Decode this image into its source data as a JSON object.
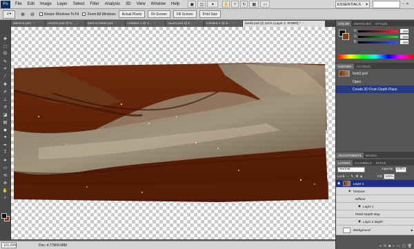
{
  "menubar": {
    "logo": "Ps",
    "items": [
      "File",
      "Edit",
      "Image",
      "Layer",
      "Select",
      "Filter",
      "Analysis",
      "3D",
      "View",
      "Window",
      "Help"
    ],
    "workspace": "ESSENTIALS"
  },
  "optbar": {
    "resize_windows": "Resize Windows To Fit",
    "zoom_all": "Zoom All Windows",
    "buttons": [
      "Actual Pixels",
      "Fit Screen",
      "Fill Screen",
      "Print Size"
    ]
  },
  "tabs": [
    {
      "label": "eleven1.psd",
      "active": false
    },
    {
      "label": "cave01.psd @ 5...",
      "active": false
    },
    {
      "label": "start-scrolder.psd",
      "active": false
    },
    {
      "label": "Untitled-1 @ 1...",
      "active": false
    },
    {
      "label": "cave3.psd @ 5...",
      "active": false
    },
    {
      "label": "Untitled-2 @ 5...",
      "active": false
    },
    {
      "label": "land2.psd @ 111% (Layer 2, RGB/8) *",
      "active": true
    }
  ],
  "status": {
    "zoom": "115.29%",
    "doc": "Doc: 4.77M/9.08M"
  },
  "color_panel": {
    "tabs": [
      "COLOR",
      "SWATCHES",
      "STYLES"
    ],
    "channels": [
      {
        "label": "R",
        "value": "255",
        "color": "#ff3b3b"
      },
      {
        "label": "G",
        "value": "255",
        "color": "#3bdc3b"
      },
      {
        "label": "B",
        "value": "255",
        "color": "#3b6bff"
      }
    ]
  },
  "history_panel": {
    "tabs": [
      "HISTORY",
      "ACTIONS"
    ],
    "snapshot": "land2.psd",
    "items": [
      {
        "label": "Open",
        "active": false
      },
      {
        "label": "Create 3D From Depth Plane",
        "active": true
      }
    ]
  },
  "adjust_tabs": [
    "ADJUSTMENTS",
    "MASKS"
  ],
  "layers_panel": {
    "tabs": [
      "LAYERS",
      "CHANNELS",
      "PATHS"
    ],
    "blend_mode": "Normal",
    "opacity_label": "Opacity:",
    "opacity": "100%",
    "lock_label": "Lock:",
    "fill_label": "Fill:",
    "fill": "100%",
    "layers": [
      {
        "label": "Layer 2",
        "active": true,
        "indent": 0
      },
      {
        "label": "Textures",
        "active": false,
        "indent": 1
      },
      {
        "label": "Diffuse",
        "active": false,
        "indent": 2
      },
      {
        "label": "Layer 1",
        "active": false,
        "indent": 3
      },
      {
        "label": "Plane Depth Map",
        "active": false,
        "indent": 2
      },
      {
        "label": "Layer 2 Depth",
        "active": false,
        "indent": 3
      },
      {
        "label": "Background",
        "active": false,
        "indent": 0
      }
    ]
  }
}
